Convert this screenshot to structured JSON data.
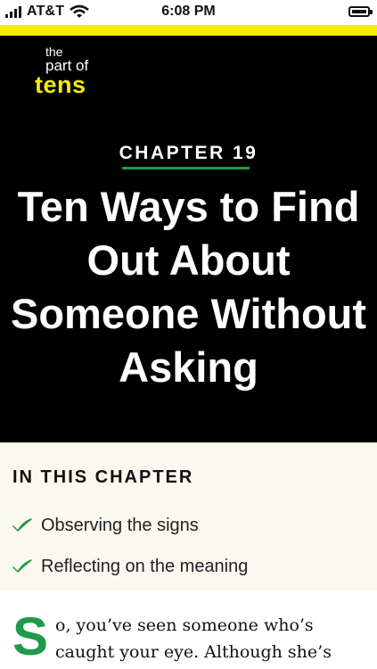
{
  "status_bar": {
    "carrier": "AT&T",
    "time": "6:08 PM",
    "icons": [
      "signal-bars-icon",
      "wifi-icon",
      "battery-icon"
    ]
  },
  "logo": {
    "line1": "the",
    "line2": "part of",
    "line3": "tens"
  },
  "chapter": {
    "label": "CHAPTER 19",
    "title": "Ten Ways to Find Out About Someone Without Asking"
  },
  "in_this_chapter": {
    "heading": "IN THIS CHAPTER",
    "items": [
      {
        "label": "Observing the signs",
        "icon": "check-icon"
      },
      {
        "label": "Reflecting on the meaning",
        "icon": "check-icon"
      }
    ]
  },
  "body": {
    "drop_cap": "S",
    "text": "o, you’ve seen someone who’s caught your eye. Although she’s"
  },
  "colors": {
    "accent_green": "#1d9a4a",
    "brand_yellow": "#f5ea0a",
    "hero_background": "#000000",
    "box_background": "#fbf8ef"
  }
}
